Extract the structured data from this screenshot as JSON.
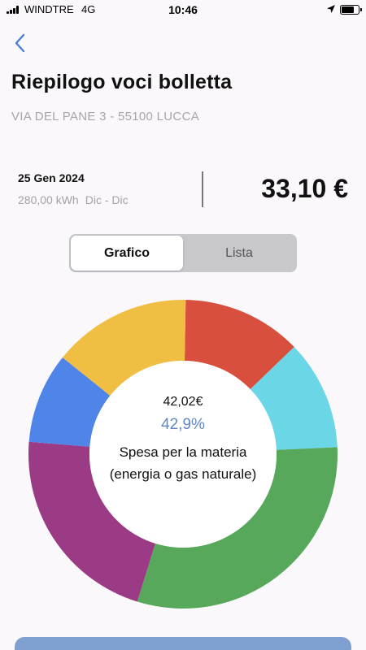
{
  "status_bar": {
    "carrier": "WINDTRE",
    "network": "4G",
    "time": "10:46",
    "battery_level": 0.8
  },
  "header": {
    "back_icon": "chevron-left-icon",
    "title": "Riepilogo voci bolletta",
    "address": "VIA DEL PANE 3 - 55100 LUCCA"
  },
  "bill": {
    "date": "25 Gen 2024",
    "kwh": "280,00 kWh",
    "period": "Dic - Dic",
    "total": "33,10 €"
  },
  "tabs": {
    "chart_label": "Grafico",
    "list_label": "Lista",
    "selected": "Grafico"
  },
  "selected_item": {
    "amount": "42,02€",
    "percent": "42,9%",
    "label": "Spesa per la materia (energia o gas naturale)"
  },
  "colors": {
    "accent": "#5f86c6",
    "button": "#7f9fd0"
  },
  "chart_data": {
    "type": "pie",
    "title": "",
    "slices": [
      {
        "value": 12.5,
        "color": "#d94f3d"
      },
      {
        "value": 11.5,
        "color": "#6ad6e6"
      },
      {
        "value": 30.5,
        "color": "#58a85c"
      },
      {
        "value": 21.5,
        "color": "#9b3a85"
      },
      {
        "value": 9.5,
        "color": "#4f84e8"
      },
      {
        "value": 14.5,
        "color": "#f0be42"
      }
    ]
  }
}
